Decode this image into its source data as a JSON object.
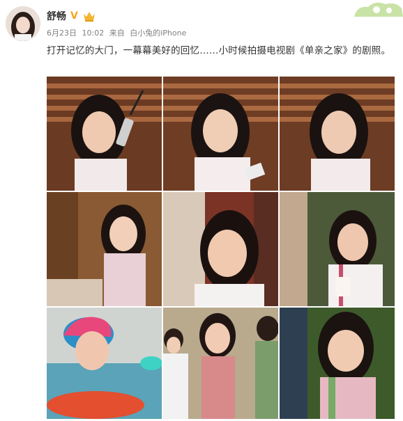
{
  "post": {
    "author_name": "舒畅",
    "verified_badge": "V",
    "date": "6月23日",
    "time": "10:02",
    "source_prefix": "来自",
    "source": "白小兔的iPhone",
    "text": "打开记忆的大门，一幕幕美好的回忆……小时候拍摄电视剧《单亲之家》的剧照。"
  },
  "icons": {
    "verified": "verified-v-icon",
    "member": "crown-member-icon",
    "corner": "decorative-cloud-icon"
  },
  "colors": {
    "author": "#333333",
    "meta": "#808080",
    "verified": "#f5a623"
  },
  "photos": [
    {
      "id": "still-1"
    },
    {
      "id": "still-2"
    },
    {
      "id": "still-3"
    },
    {
      "id": "still-4"
    },
    {
      "id": "still-5"
    },
    {
      "id": "still-6"
    },
    {
      "id": "still-7"
    },
    {
      "id": "still-8"
    },
    {
      "id": "still-9"
    }
  ]
}
